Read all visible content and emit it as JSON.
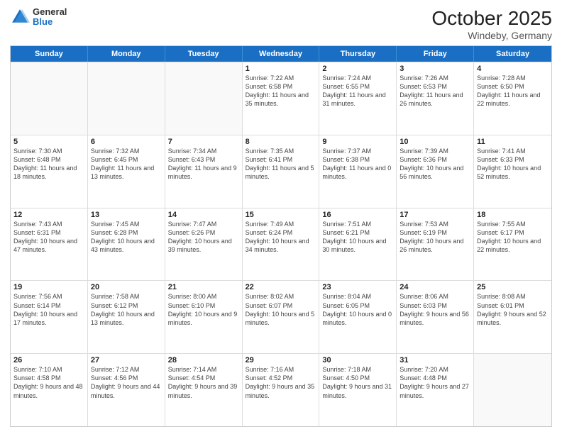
{
  "header": {
    "logo_line1": "General",
    "logo_line2": "Blue",
    "title": "October 2025",
    "subtitle": "Windeby, Germany"
  },
  "days_of_week": [
    "Sunday",
    "Monday",
    "Tuesday",
    "Wednesday",
    "Thursday",
    "Friday",
    "Saturday"
  ],
  "weeks": [
    [
      {
        "day": "",
        "text": "",
        "empty": true
      },
      {
        "day": "",
        "text": "",
        "empty": true
      },
      {
        "day": "",
        "text": "",
        "empty": true
      },
      {
        "day": "1",
        "text": "Sunrise: 7:22 AM\nSunset: 6:58 PM\nDaylight: 11 hours and 35 minutes."
      },
      {
        "day": "2",
        "text": "Sunrise: 7:24 AM\nSunset: 6:55 PM\nDaylight: 11 hours and 31 minutes."
      },
      {
        "day": "3",
        "text": "Sunrise: 7:26 AM\nSunset: 6:53 PM\nDaylight: 11 hours and 26 minutes."
      },
      {
        "day": "4",
        "text": "Sunrise: 7:28 AM\nSunset: 6:50 PM\nDaylight: 11 hours and 22 minutes."
      }
    ],
    [
      {
        "day": "5",
        "text": "Sunrise: 7:30 AM\nSunset: 6:48 PM\nDaylight: 11 hours and 18 minutes."
      },
      {
        "day": "6",
        "text": "Sunrise: 7:32 AM\nSunset: 6:45 PM\nDaylight: 11 hours and 13 minutes."
      },
      {
        "day": "7",
        "text": "Sunrise: 7:34 AM\nSunset: 6:43 PM\nDaylight: 11 hours and 9 minutes."
      },
      {
        "day": "8",
        "text": "Sunrise: 7:35 AM\nSunset: 6:41 PM\nDaylight: 11 hours and 5 minutes."
      },
      {
        "day": "9",
        "text": "Sunrise: 7:37 AM\nSunset: 6:38 PM\nDaylight: 11 hours and 0 minutes."
      },
      {
        "day": "10",
        "text": "Sunrise: 7:39 AM\nSunset: 6:36 PM\nDaylight: 10 hours and 56 minutes."
      },
      {
        "day": "11",
        "text": "Sunrise: 7:41 AM\nSunset: 6:33 PM\nDaylight: 10 hours and 52 minutes."
      }
    ],
    [
      {
        "day": "12",
        "text": "Sunrise: 7:43 AM\nSunset: 6:31 PM\nDaylight: 10 hours and 47 minutes."
      },
      {
        "day": "13",
        "text": "Sunrise: 7:45 AM\nSunset: 6:28 PM\nDaylight: 10 hours and 43 minutes."
      },
      {
        "day": "14",
        "text": "Sunrise: 7:47 AM\nSunset: 6:26 PM\nDaylight: 10 hours and 39 minutes."
      },
      {
        "day": "15",
        "text": "Sunrise: 7:49 AM\nSunset: 6:24 PM\nDaylight: 10 hours and 34 minutes."
      },
      {
        "day": "16",
        "text": "Sunrise: 7:51 AM\nSunset: 6:21 PM\nDaylight: 10 hours and 30 minutes."
      },
      {
        "day": "17",
        "text": "Sunrise: 7:53 AM\nSunset: 6:19 PM\nDaylight: 10 hours and 26 minutes."
      },
      {
        "day": "18",
        "text": "Sunrise: 7:55 AM\nSunset: 6:17 PM\nDaylight: 10 hours and 22 minutes."
      }
    ],
    [
      {
        "day": "19",
        "text": "Sunrise: 7:56 AM\nSunset: 6:14 PM\nDaylight: 10 hours and 17 minutes."
      },
      {
        "day": "20",
        "text": "Sunrise: 7:58 AM\nSunset: 6:12 PM\nDaylight: 10 hours and 13 minutes."
      },
      {
        "day": "21",
        "text": "Sunrise: 8:00 AM\nSunset: 6:10 PM\nDaylight: 10 hours and 9 minutes."
      },
      {
        "day": "22",
        "text": "Sunrise: 8:02 AM\nSunset: 6:07 PM\nDaylight: 10 hours and 5 minutes."
      },
      {
        "day": "23",
        "text": "Sunrise: 8:04 AM\nSunset: 6:05 PM\nDaylight: 10 hours and 0 minutes."
      },
      {
        "day": "24",
        "text": "Sunrise: 8:06 AM\nSunset: 6:03 PM\nDaylight: 9 hours and 56 minutes."
      },
      {
        "day": "25",
        "text": "Sunrise: 8:08 AM\nSunset: 6:01 PM\nDaylight: 9 hours and 52 minutes."
      }
    ],
    [
      {
        "day": "26",
        "text": "Sunrise: 7:10 AM\nSunset: 4:58 PM\nDaylight: 9 hours and 48 minutes."
      },
      {
        "day": "27",
        "text": "Sunrise: 7:12 AM\nSunset: 4:56 PM\nDaylight: 9 hours and 44 minutes."
      },
      {
        "day": "28",
        "text": "Sunrise: 7:14 AM\nSunset: 4:54 PM\nDaylight: 9 hours and 39 minutes."
      },
      {
        "day": "29",
        "text": "Sunrise: 7:16 AM\nSunset: 4:52 PM\nDaylight: 9 hours and 35 minutes."
      },
      {
        "day": "30",
        "text": "Sunrise: 7:18 AM\nSunset: 4:50 PM\nDaylight: 9 hours and 31 minutes."
      },
      {
        "day": "31",
        "text": "Sunrise: 7:20 AM\nSunset: 4:48 PM\nDaylight: 9 hours and 27 minutes."
      },
      {
        "day": "",
        "text": "",
        "empty": true
      }
    ]
  ]
}
